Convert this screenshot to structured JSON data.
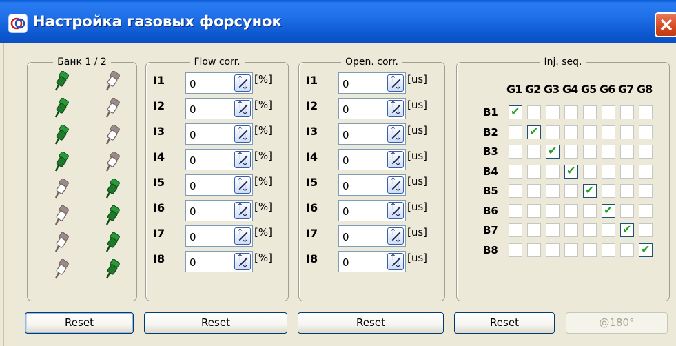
{
  "window": {
    "title": "Настройка газовых форсунок",
    "close_icon": "close-icon"
  },
  "bank": {
    "title": "Банк 1 / 2",
    "rows": [
      [
        "green",
        "gray"
      ],
      [
        "green",
        "gray"
      ],
      [
        "green",
        "gray"
      ],
      [
        "green",
        "gray"
      ],
      [
        "gray",
        "green"
      ],
      [
        "gray",
        "green"
      ],
      [
        "gray",
        "green"
      ],
      [
        "gray",
        "green"
      ]
    ]
  },
  "flow": {
    "title": "Flow corr.",
    "unit": "[%]",
    "rows": [
      {
        "label": "I1",
        "value": "0"
      },
      {
        "label": "I2",
        "value": "0"
      },
      {
        "label": "I3",
        "value": "0"
      },
      {
        "label": "I4",
        "value": "0"
      },
      {
        "label": "I5",
        "value": "0"
      },
      {
        "label": "I6",
        "value": "0"
      },
      {
        "label": "I7",
        "value": "0"
      },
      {
        "label": "I8",
        "value": "0"
      }
    ]
  },
  "open": {
    "title": "Open. corr.",
    "unit": "[us]",
    "rows": [
      {
        "label": "I1",
        "value": "0"
      },
      {
        "label": "I2",
        "value": "0"
      },
      {
        "label": "I3",
        "value": "0"
      },
      {
        "label": "I4",
        "value": "0"
      },
      {
        "label": "I5",
        "value": "0"
      },
      {
        "label": "I6",
        "value": "0"
      },
      {
        "label": "I7",
        "value": "0"
      },
      {
        "label": "I8",
        "value": "0"
      }
    ]
  },
  "inj": {
    "title": "Inj. seq.",
    "columns": [
      "G1",
      "G2",
      "G3",
      "G4",
      "G5",
      "G6",
      "G7",
      "G8"
    ],
    "rows": [
      "B1",
      "B2",
      "B3",
      "B4",
      "B5",
      "B6",
      "B7",
      "B8"
    ],
    "checked": [
      1,
      2,
      3,
      4,
      5,
      6,
      7,
      8
    ],
    "tick_color": "#21a121"
  },
  "buttons": {
    "reset1": "Reset",
    "reset2": "Reset",
    "reset3": "Reset",
    "reset4": "Reset",
    "rotate": "@180°"
  },
  "colors": {
    "title_bar": "#0d58d0",
    "window_bg": "#ece9d8",
    "injector_green": "#1e7a2a",
    "injector_gray": "#9a8a8a"
  }
}
